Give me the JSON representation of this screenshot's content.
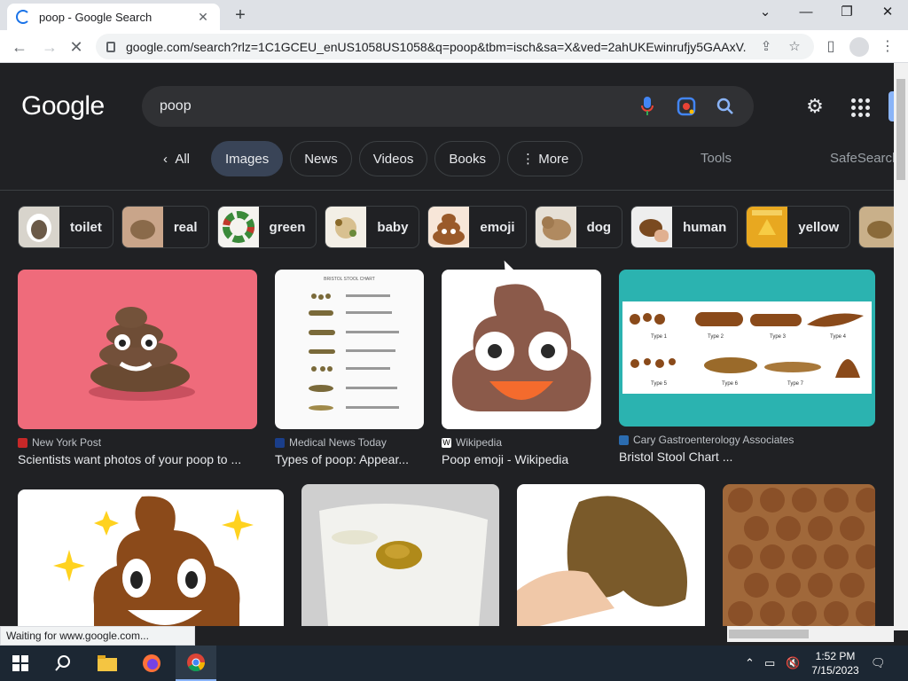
{
  "browser": {
    "tab_title": "poop - Google Search",
    "url": "google.com/search?rlz=1C1GCEU_enUS1058US1058&q=poop&tbm=isch&sa=X&ved=2ahUKEwinrufjy5GAAxV...",
    "status_text": "Waiting for www.google.com..."
  },
  "google": {
    "logo": "Google",
    "query": "poop",
    "tabs": [
      "All",
      "Images",
      "News",
      "Videos",
      "Books",
      "More"
    ],
    "active_tab": "Images",
    "tools": "Tools",
    "safesearch": "SafeSearch"
  },
  "chips": [
    {
      "label": "toilet",
      "color": "#6b5a48"
    },
    {
      "label": "real",
      "color": "#8a6a4a"
    },
    {
      "label": "green",
      "color": "#e8e6e0"
    },
    {
      "label": "baby",
      "color": "#d8d0c0"
    },
    {
      "label": "emoji",
      "color": "#9a5a2a"
    },
    {
      "label": "dog",
      "color": "#b08a60"
    },
    {
      "label": "human",
      "color": "#7a4a20"
    },
    {
      "label": "yellow",
      "color": "#e8a820"
    }
  ],
  "results": [
    {
      "source": "New York Post",
      "title": "Scientists want photos of your poop to ...",
      "favicon_color": "#c62828"
    },
    {
      "source": "Medical News Today",
      "title": "Types of poop: Appear...",
      "favicon_color": "#1a3e8a"
    },
    {
      "source": "Wikipedia",
      "title": "Poop emoji - Wikipedia",
      "favicon_color": "#ffffff"
    },
    {
      "source": "Cary Gastroenterology Associates",
      "title": "Bristol Stool Chart ...",
      "favicon_color": "#2b6cb0"
    }
  ],
  "chart_labels": {
    "stool_types": [
      "Type 1",
      "Type 2",
      "Type 3",
      "Type 4",
      "Type 5",
      "Type 6",
      "Type 7"
    ],
    "bristol_title": "BRISTOL STOOL CHART"
  },
  "taskbar": {
    "time": "1:52 PM",
    "date": "7/15/2023"
  },
  "colors": {
    "page_bg": "#202124",
    "accent": "#8ab4f8",
    "poop_brown": "#8b5a2b"
  }
}
